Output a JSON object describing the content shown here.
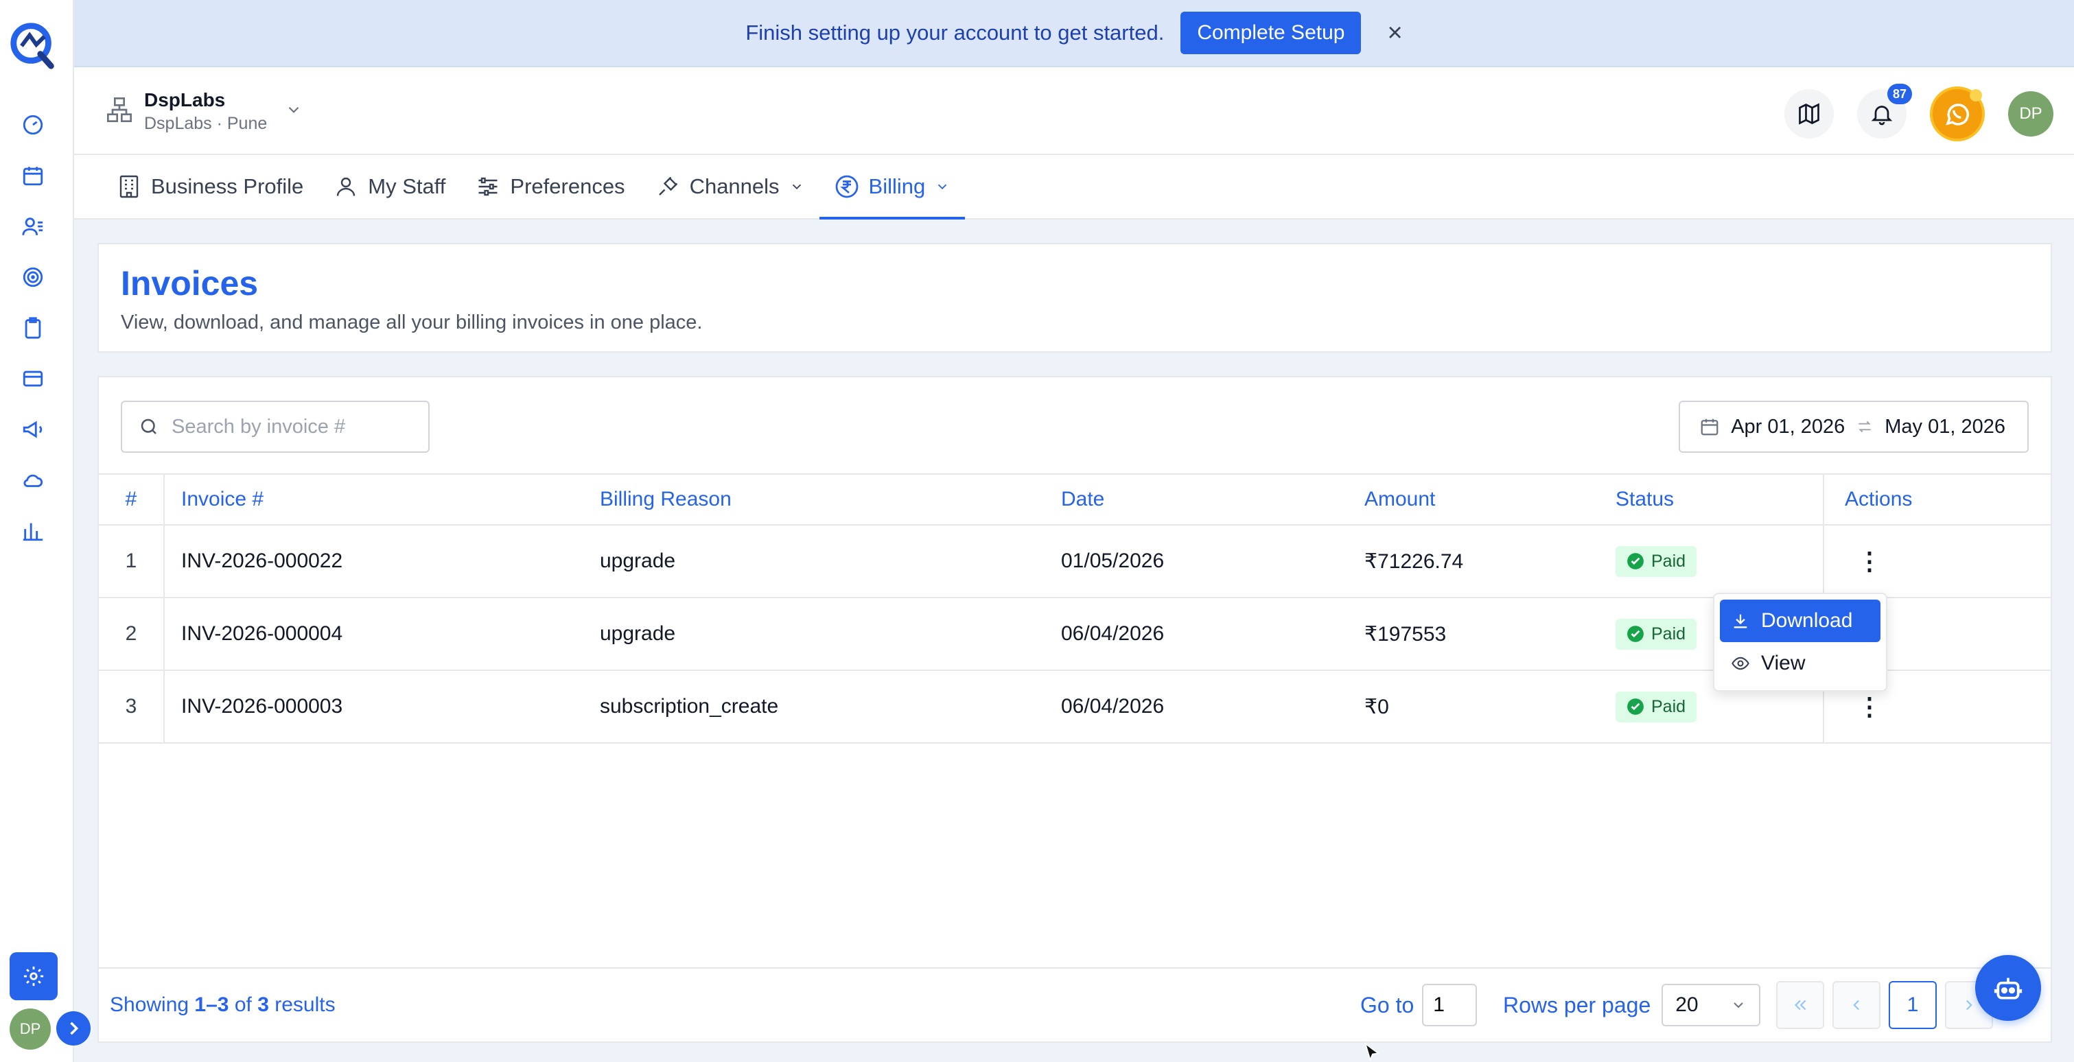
{
  "banner": {
    "message": "Finish setting up your account to get started.",
    "cta_label": "Complete Setup",
    "close_glyph": "×"
  },
  "org": {
    "name": "DspLabs",
    "subtitle": "DspLabs · Pune"
  },
  "header": {
    "notification_count": "87",
    "user_initials": "DP"
  },
  "tabs": [
    {
      "label": "Business Profile",
      "icon": "building-icon"
    },
    {
      "label": "My Staff",
      "icon": "user-icon"
    },
    {
      "label": "Preferences",
      "icon": "sliders-icon"
    },
    {
      "label": "Channels",
      "icon": "plug-icon"
    },
    {
      "label": "Billing",
      "icon": "rupee-icon",
      "active": true
    }
  ],
  "page": {
    "title": "Invoices",
    "subtitle": "View, download, and manage all your billing invoices in one place."
  },
  "search": {
    "placeholder": "Search by invoice #",
    "value": ""
  },
  "date_range": {
    "start": "Apr 01, 2026",
    "end": "May 01, 2026"
  },
  "table": {
    "columns": [
      "#",
      "Invoice #",
      "Billing Reason",
      "Date",
      "Amount",
      "Status",
      "Actions"
    ],
    "rows": [
      {
        "idx": "1",
        "invoice": "INV-2026-000022",
        "reason": "upgrade",
        "date": "01/05/2026",
        "amount": "₹71226.74",
        "status": "Paid"
      },
      {
        "idx": "2",
        "invoice": "INV-2026-000004",
        "reason": "upgrade",
        "date": "06/04/2026",
        "amount": "₹197553",
        "status": "Paid"
      },
      {
        "idx": "3",
        "invoice": "INV-2026-000003",
        "reason": "subscription_create",
        "date": "06/04/2026",
        "amount": "₹0",
        "status": "Paid"
      }
    ]
  },
  "action_menu": {
    "download": "Download",
    "view": "View"
  },
  "footer": {
    "showing_prefix": "Showing",
    "showing_range": "1–3",
    "showing_of": "of",
    "showing_total": "3",
    "showing_suffix": "results",
    "goto_label": "Go to",
    "goto_value": "1",
    "rows_per_page_label": "Rows per page",
    "rows_per_page_value": "20",
    "current_page": "1"
  },
  "rail": {
    "user_initials": "DP"
  },
  "colors": {
    "accent": "#2563eb",
    "paid_bg": "#dcfce7",
    "paid_fg": "#166534"
  }
}
